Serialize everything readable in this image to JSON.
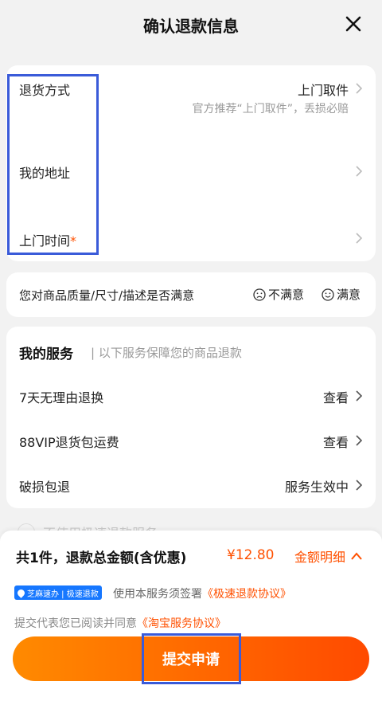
{
  "header": {
    "title": "确认退款信息"
  },
  "return_card": {
    "method_label": "退货方式",
    "method_value": "上门取件",
    "method_sub": "官方推荐“上门取件”，丢损必赔",
    "address_label": "我的地址",
    "time_label": "上门时间",
    "time_required_mark": "*"
  },
  "satisfaction": {
    "question": "您对商品质量/尺寸/描述是否满意",
    "dissatisfied": "不满意",
    "satisfied": "满意"
  },
  "services": {
    "title": "我的服务",
    "subtitle": "| 以下服务保障您的商品退款",
    "items": [
      {
        "label": "7天无理由退换",
        "value": "查看"
      },
      {
        "label": "88VIP退货包运费",
        "value": "查看"
      },
      {
        "label": "破损包退",
        "value": "服务生效中"
      }
    ]
  },
  "faded_option": "不使用极速退款服务",
  "bottom": {
    "total_label": "共1件，退款总金额(含优惠)",
    "total_amount": "¥12.80",
    "detail_label": "金额明细",
    "badge_text": "芝麻速办 | 极速退款",
    "agree1_prefix": "使用本服务须签署",
    "agree1_link": "《极速退款协议》",
    "agree2_prefix": "提交代表您已阅读并同意",
    "agree2_link": "《淘宝服务协议》",
    "submit_label": "提交申请"
  },
  "colors": {
    "accent": "#ff5000",
    "highlight": "#3a5bd9",
    "badge": "#1677ff"
  }
}
